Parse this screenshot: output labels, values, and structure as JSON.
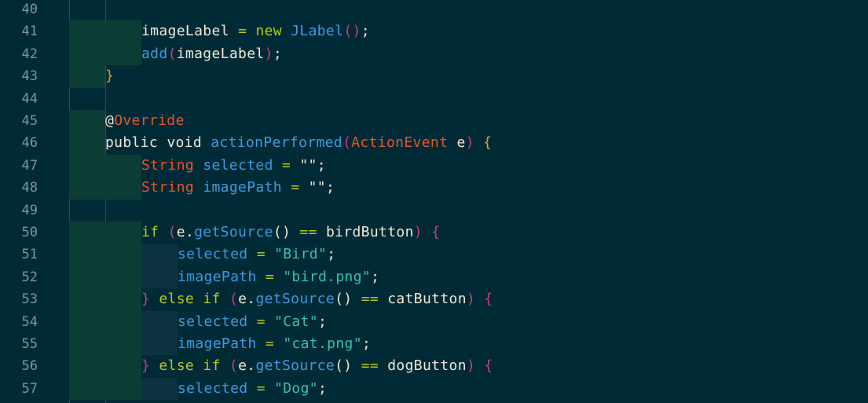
{
  "colors": {
    "background": "#002b36",
    "line_number": "#839496",
    "text": "#eee8d5",
    "keyword": "#b5c91b",
    "type_orange": "#e0562b",
    "method_blue": "#3f9ae0",
    "string_green": "#36c2b0",
    "annotation": "#e0562b",
    "paren_yellow": "#d6a520",
    "paren_magenta": "#d33682",
    "indent_block_green": "#0b3d34",
    "indent_block_blue": "#0d3342"
  },
  "lines": [
    {
      "number": "40",
      "indent": 0,
      "tokens": []
    },
    {
      "number": "41",
      "indent": 2,
      "tokens": [
        {
          "t": "imageLabel ",
          "c": "text"
        },
        {
          "t": "= ",
          "c": "keyword"
        },
        {
          "t": "new ",
          "c": "keyword"
        },
        {
          "t": "JLabel",
          "c": "method_blue"
        },
        {
          "t": "()",
          "c": "paren_magenta"
        },
        {
          "t": ";",
          "c": "text"
        }
      ]
    },
    {
      "number": "42",
      "indent": 2,
      "tokens": [
        {
          "t": "add",
          "c": "method_blue"
        },
        {
          "t": "(",
          "c": "paren_magenta"
        },
        {
          "t": "imageLabel",
          "c": "text"
        },
        {
          "t": ")",
          "c": "paren_magenta"
        },
        {
          "t": ";",
          "c": "text"
        }
      ]
    },
    {
      "number": "43",
      "indent": 1,
      "tokens": [
        {
          "t": "}",
          "c": "paren_yellow"
        }
      ]
    },
    {
      "number": "44",
      "indent": 0,
      "tokens": []
    },
    {
      "number": "45",
      "indent": 1,
      "tokens": [
        {
          "t": "@",
          "c": "text"
        },
        {
          "t": "Override",
          "c": "annotation"
        }
      ]
    },
    {
      "number": "46",
      "indent": 1,
      "tokens": [
        {
          "t": "public ",
          "c": "text"
        },
        {
          "t": "void ",
          "c": "text"
        },
        {
          "t": "actionPerformed",
          "c": "method_blue"
        },
        {
          "t": "(",
          "c": "paren_magenta"
        },
        {
          "t": "ActionEvent ",
          "c": "type_orange"
        },
        {
          "t": "e",
          "c": "text"
        },
        {
          "t": ") ",
          "c": "paren_magenta"
        },
        {
          "t": "{",
          "c": "paren_yellow"
        }
      ]
    },
    {
      "number": "47",
      "indent": 2,
      "tokens": [
        {
          "t": "String ",
          "c": "type_orange"
        },
        {
          "t": "selected ",
          "c": "method_blue"
        },
        {
          "t": "= ",
          "c": "keyword"
        },
        {
          "t": "\"\"",
          "c": "text"
        },
        {
          "t": ";",
          "c": "text"
        }
      ]
    },
    {
      "number": "48",
      "indent": 2,
      "tokens": [
        {
          "t": "String ",
          "c": "type_orange"
        },
        {
          "t": "imagePath ",
          "c": "method_blue"
        },
        {
          "t": "= ",
          "c": "keyword"
        },
        {
          "t": "\"\"",
          "c": "text"
        },
        {
          "t": ";",
          "c": "text"
        }
      ]
    },
    {
      "number": "49",
      "indent": 0,
      "tokens": []
    },
    {
      "number": "50",
      "indent": 2,
      "tokens": [
        {
          "t": "if ",
          "c": "keyword"
        },
        {
          "t": "(",
          "c": "paren_magenta"
        },
        {
          "t": "e",
          "c": "text"
        },
        {
          "t": ".",
          "c": "text"
        },
        {
          "t": "getSource",
          "c": "method_blue"
        },
        {
          "t": "() ",
          "c": "text"
        },
        {
          "t": "== ",
          "c": "keyword"
        },
        {
          "t": "birdButton",
          "c": "text"
        },
        {
          "t": ") ",
          "c": "paren_magenta"
        },
        {
          "t": "{",
          "c": "paren_magenta"
        }
      ]
    },
    {
      "number": "51",
      "indent": 3,
      "tokens": [
        {
          "t": "selected ",
          "c": "method_blue"
        },
        {
          "t": "= ",
          "c": "keyword"
        },
        {
          "t": "\"Bird\"",
          "c": "string_green"
        },
        {
          "t": ";",
          "c": "text"
        }
      ]
    },
    {
      "number": "52",
      "indent": 3,
      "tokens": [
        {
          "t": "imagePath ",
          "c": "method_blue"
        },
        {
          "t": "= ",
          "c": "keyword"
        },
        {
          "t": "\"bird.png\"",
          "c": "string_green"
        },
        {
          "t": ";",
          "c": "text"
        }
      ]
    },
    {
      "number": "53",
      "indent": 2,
      "tokens": [
        {
          "t": "} ",
          "c": "paren_magenta"
        },
        {
          "t": "else ",
          "c": "keyword"
        },
        {
          "t": "if ",
          "c": "keyword"
        },
        {
          "t": "(",
          "c": "paren_magenta"
        },
        {
          "t": "e",
          "c": "text"
        },
        {
          "t": ".",
          "c": "text"
        },
        {
          "t": "getSource",
          "c": "method_blue"
        },
        {
          "t": "() ",
          "c": "text"
        },
        {
          "t": "== ",
          "c": "keyword"
        },
        {
          "t": "catButton",
          "c": "text"
        },
        {
          "t": ") ",
          "c": "paren_magenta"
        },
        {
          "t": "{",
          "c": "paren_magenta"
        }
      ]
    },
    {
      "number": "54",
      "indent": 3,
      "tokens": [
        {
          "t": "selected ",
          "c": "method_blue"
        },
        {
          "t": "= ",
          "c": "keyword"
        },
        {
          "t": "\"Cat\"",
          "c": "string_green"
        },
        {
          "t": ";",
          "c": "text"
        }
      ]
    },
    {
      "number": "55",
      "indent": 3,
      "tokens": [
        {
          "t": "imagePath ",
          "c": "method_blue"
        },
        {
          "t": "= ",
          "c": "keyword"
        },
        {
          "t": "\"cat.png\"",
          "c": "string_green"
        },
        {
          "t": ";",
          "c": "text"
        }
      ]
    },
    {
      "number": "56",
      "indent": 2,
      "tokens": [
        {
          "t": "} ",
          "c": "paren_magenta"
        },
        {
          "t": "else ",
          "c": "keyword"
        },
        {
          "t": "if ",
          "c": "keyword"
        },
        {
          "t": "(",
          "c": "paren_magenta"
        },
        {
          "t": "e",
          "c": "text"
        },
        {
          "t": ".",
          "c": "text"
        },
        {
          "t": "getSource",
          "c": "method_blue"
        },
        {
          "t": "() ",
          "c": "text"
        },
        {
          "t": "== ",
          "c": "keyword"
        },
        {
          "t": "dogButton",
          "c": "text"
        },
        {
          "t": ") ",
          "c": "paren_magenta"
        },
        {
          "t": "{",
          "c": "paren_magenta"
        }
      ]
    },
    {
      "number": "57",
      "indent": 3,
      "tokens": [
        {
          "t": "selected ",
          "c": "method_blue"
        },
        {
          "t": "= ",
          "c": "keyword"
        },
        {
          "t": "\"Dog\"",
          "c": "string_green"
        },
        {
          "t": ";",
          "c": "text"
        }
      ]
    }
  ]
}
